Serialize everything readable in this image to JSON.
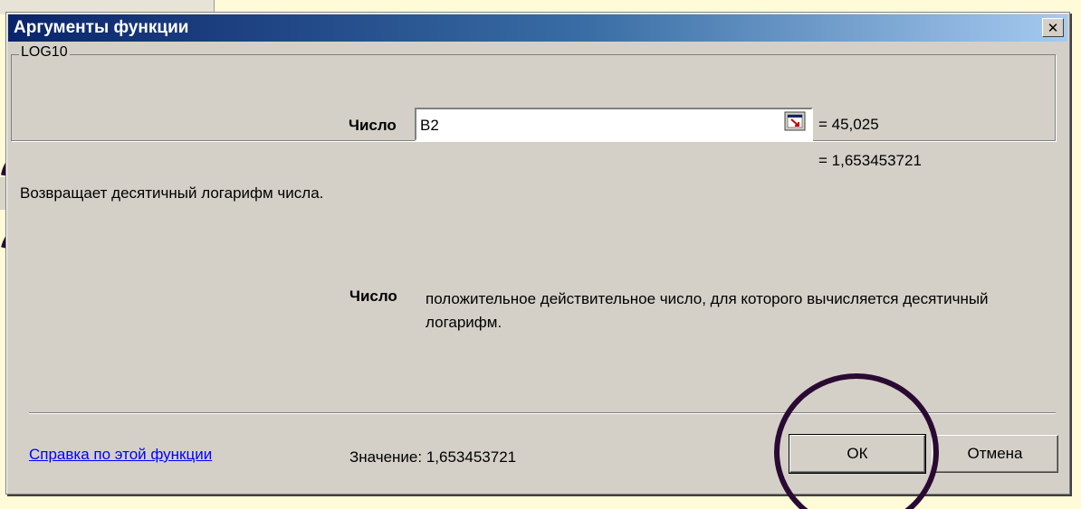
{
  "dialog": {
    "title": "Аргументы функции",
    "close_glyph": "✕",
    "function_name": "LOG10",
    "argument": {
      "label": "Число",
      "value": "B2",
      "evaluated": "= 45,025"
    },
    "result_line": "= 1,653453721",
    "description": "Возвращает десятичный логарифм числа.",
    "argument_help": {
      "name": "Число",
      "text": "положительное действительное число, для которого вычисляется десятичный логарифм."
    },
    "help_link": "Справка по этой функции",
    "value_label": "Значение: 1,653453721",
    "buttons": {
      "ok": "ОК",
      "cancel": "Отмена"
    }
  },
  "icons": {
    "collapse": "range-select-icon",
    "close": "close-icon"
  },
  "colors": {
    "annotation": "#2a0a33",
    "background": "#fffbd9",
    "dialog": "#d4d0c8"
  }
}
